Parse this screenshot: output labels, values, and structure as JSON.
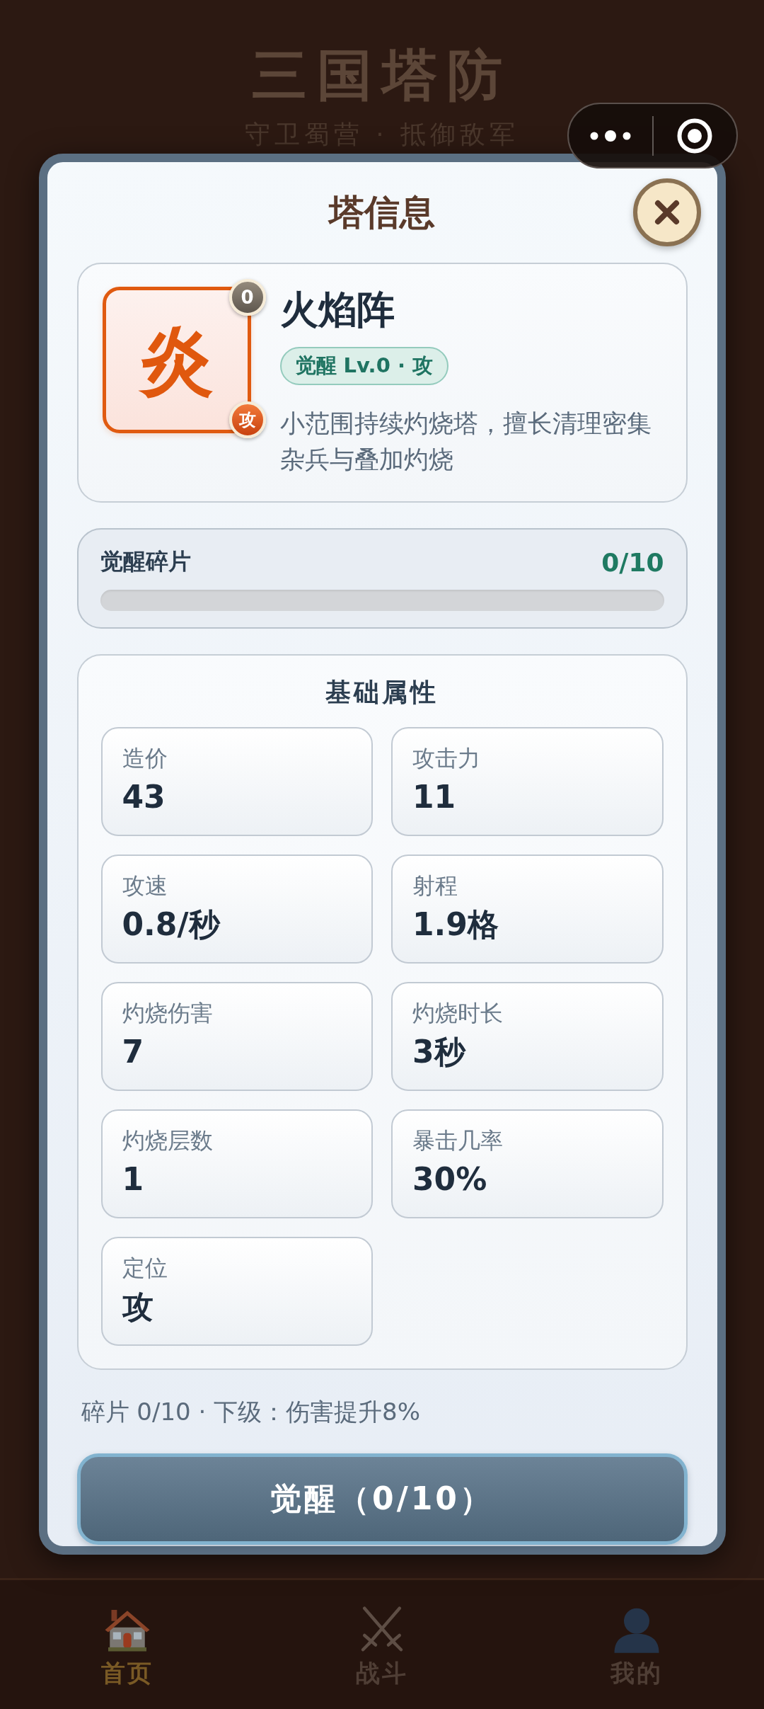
{
  "header": {
    "title": "三国塔防",
    "subtitle": "守卫蜀营 · 抵御敌军"
  },
  "modal": {
    "title": "塔信息",
    "tower": {
      "glyph": "炎",
      "badges": [
        {
          "text": "0",
          "kind": "level"
        },
        {
          "text": "攻",
          "kind": "role"
        }
      ],
      "name": "火焰阵",
      "tag": "觉醒 Lv.0 · 攻",
      "description": "小范围持续灼烧塔，擅长清理密集杂兵与叠加灼烧"
    },
    "fragments": {
      "label": "觉醒碎片",
      "count": "0/10"
    },
    "stats": {
      "title": "基础属性",
      "items": [
        {
          "label": "造价",
          "value": "43"
        },
        {
          "label": "攻击力",
          "value": "11"
        },
        {
          "label": "攻速",
          "value": "0.8/秒"
        },
        {
          "label": "射程",
          "value": "1.9格"
        },
        {
          "label": "灼烧伤害",
          "value": "7"
        },
        {
          "label": "灼烧时长",
          "value": "3秒"
        },
        {
          "label": "灼烧层数",
          "value": "1"
        },
        {
          "label": "暴击几率",
          "value": "30%"
        },
        {
          "label": "定位",
          "value": "攻"
        }
      ]
    },
    "note": "碎片 0/10 · 下级：伤害提升8%",
    "button": "觉醒（0/10）"
  },
  "nav": [
    {
      "label": "首页",
      "selected": true
    },
    {
      "label": "战斗",
      "selected": false
    },
    {
      "label": "我的",
      "selected": false
    }
  ]
}
